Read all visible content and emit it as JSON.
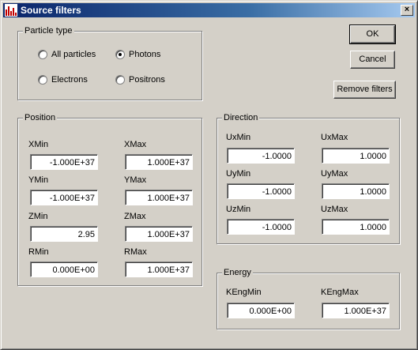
{
  "window": {
    "title": "Source filters",
    "close_glyph": "×"
  },
  "buttons": {
    "ok": "OK",
    "cancel": "Cancel",
    "remove_filters": "Remove filters"
  },
  "particle_type": {
    "title": "Particle type",
    "options": [
      {
        "label": "All particles",
        "checked": false
      },
      {
        "label": "Photons",
        "checked": true
      },
      {
        "label": "Electrons",
        "checked": false
      },
      {
        "label": "Positrons",
        "checked": false
      }
    ]
  },
  "position": {
    "title": "Position",
    "fields": [
      {
        "label": "XMin",
        "value": "-1.000E+37"
      },
      {
        "label": "XMax",
        "value": "1.000E+37"
      },
      {
        "label": "YMin",
        "value": "-1.000E+37"
      },
      {
        "label": "YMax",
        "value": "1.000E+37"
      },
      {
        "label": "ZMin",
        "value": "2.95"
      },
      {
        "label": "ZMax",
        "value": "1.000E+37"
      },
      {
        "label": "RMin",
        "value": "0.000E+00"
      },
      {
        "label": "RMax",
        "value": "1.000E+37"
      }
    ]
  },
  "direction": {
    "title": "Direction",
    "fields": [
      {
        "label": "UxMin",
        "value": "-1.0000"
      },
      {
        "label": "UxMax",
        "value": "1.0000"
      },
      {
        "label": "UyMin",
        "value": "-1.0000"
      },
      {
        "label": "UyMax",
        "value": "1.0000"
      },
      {
        "label": "UzMin",
        "value": "-1.0000"
      },
      {
        "label": "UzMax",
        "value": "1.0000"
      }
    ]
  },
  "energy": {
    "title": "Energy",
    "fields": [
      {
        "label": "KEngMin",
        "value": "0.000E+00"
      },
      {
        "label": "KEngMax",
        "value": "1.000E+37"
      }
    ]
  },
  "colors": {
    "title_start": "#0a246a",
    "title_end": "#a6caf0",
    "face": "#d4d0c8"
  },
  "icons": {
    "app": "bar-chart-icon",
    "close": "close-icon"
  }
}
